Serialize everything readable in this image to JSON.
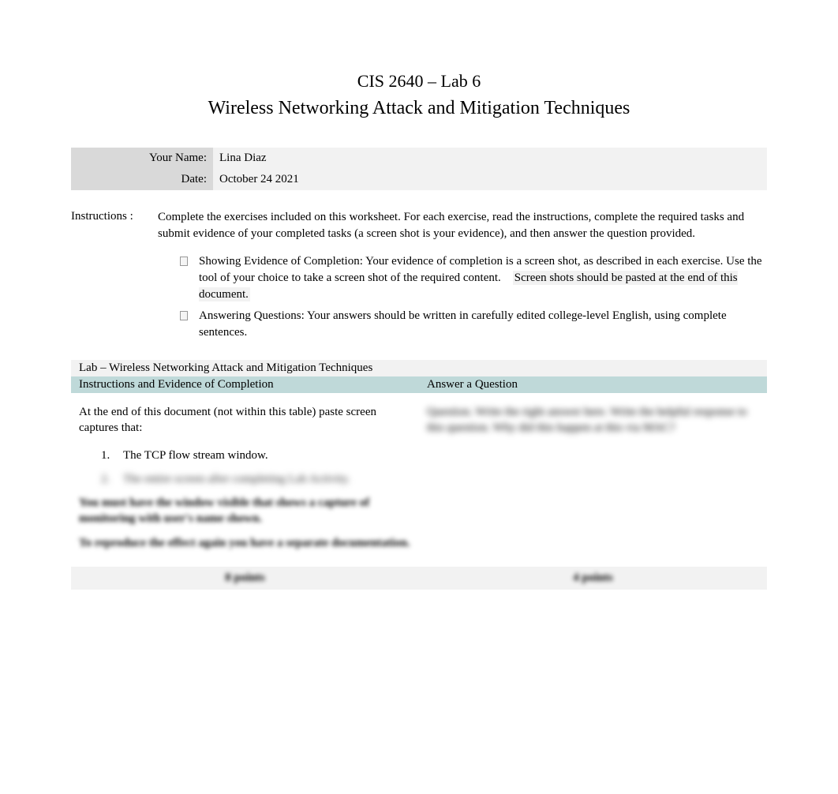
{
  "header": {
    "course": "CIS 2640 – Lab 6",
    "title": "Wireless Networking Attack and Mitigation Techniques"
  },
  "info": {
    "name_label": "Your Name:",
    "name_value": "Lina Diaz",
    "date_label": "Date:",
    "date_value": "October 24 2021"
  },
  "instructions": {
    "label": "Instructions :",
    "intro": "Complete the exercises included on this worksheet. For each exercise, read the instructions, complete the required tasks and submit evidence of your completed tasks (a screen shot is your evidence), and then answer the question provided.",
    "bullets": [
      {
        "lead": "Showing Evidence of Completion: ",
        "body": "Your evidence of completion is a screen shot, as described in each exercise. Use the tool of your choice to take a screen shot of the required content.",
        "highlight": "Screen shots should be pasted at the end of this document."
      },
      {
        "lead": "Answering Questions: ",
        "body": "Your answers should be written in carefully edited college-level English, using complete sentences.",
        "highlight": ""
      }
    ]
  },
  "table": {
    "title": "Lab – Wireless Networking Attack and Mitigation Techniques",
    "left_header": "Instructions and Evidence of Completion",
    "right_header": "Answer a Question",
    "left_content": {
      "intro": "At the end of this document (not within this table) paste screen captures that:",
      "items": [
        {
          "num": "1.",
          "text": "The TCP flow stream window."
        },
        {
          "num": "2.",
          "text": "The entire screen after completing Lab Activity."
        }
      ],
      "blurred1": "You must have the window visible that shows a capture of monitoring with user's name shown.",
      "blurred2": "To reproduce the effect again you have a separate documentation."
    },
    "right_content": {
      "blurred": "Question. Write the right answer here. Write the helpful response to this question. Why did this happen at this via MAC?"
    },
    "points": {
      "left": "8 points",
      "right": "4 points"
    }
  }
}
